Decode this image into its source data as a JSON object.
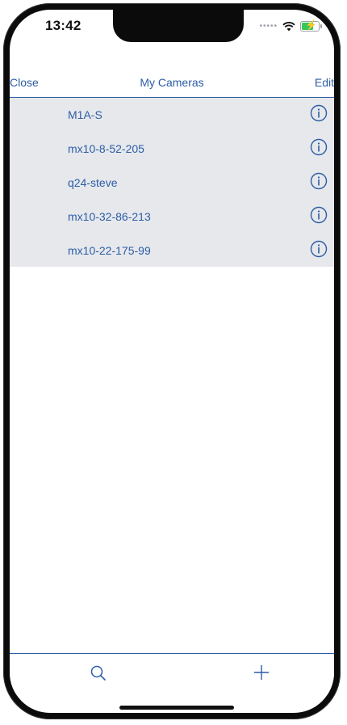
{
  "status_bar": {
    "time": "13:42",
    "signal_icon": "signal-dots-icon",
    "wifi_icon": "wifi-icon",
    "battery_icon": "battery-charging-icon",
    "battery_color": "#35c759"
  },
  "navbar": {
    "left_label": "Close",
    "title": "My Cameras",
    "right_label": "Edit"
  },
  "cameras": [
    {
      "name": "M1A-S",
      "info_icon": "info-icon"
    },
    {
      "name": "mx10-8-52-205",
      "info_icon": "info-icon"
    },
    {
      "name": "q24-steve",
      "info_icon": "info-icon"
    },
    {
      "name": "mx10-32-86-213",
      "info_icon": "info-icon"
    },
    {
      "name": "mx10-22-175-99",
      "info_icon": "info-icon"
    }
  ],
  "toolbar": {
    "search_icon": "search-icon",
    "add_icon": "plus-icon"
  },
  "colors": {
    "accent": "#2d5da6",
    "list_background": "#e6e8ec"
  }
}
